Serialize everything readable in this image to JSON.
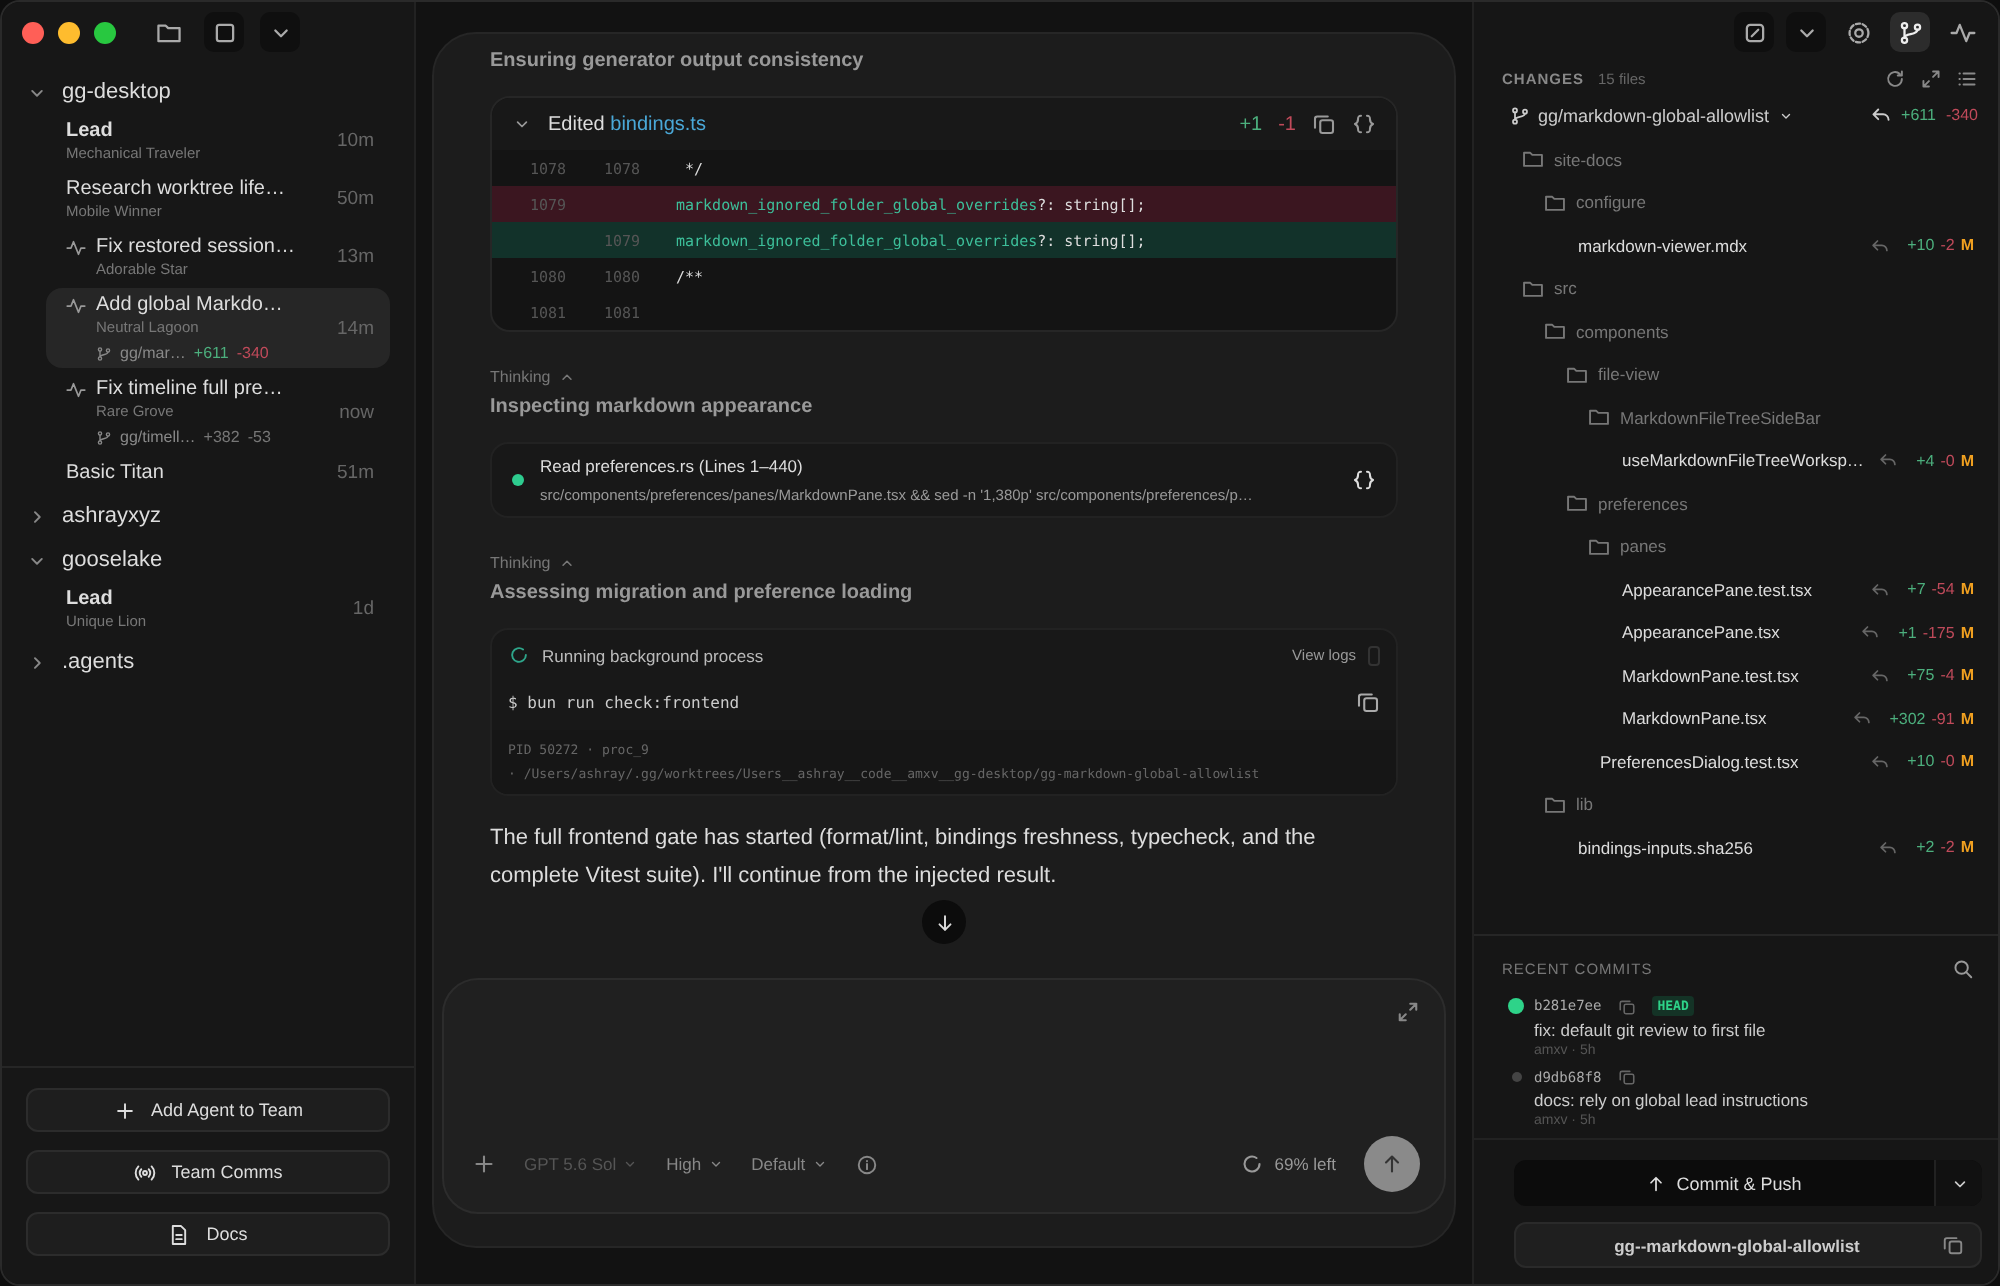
{
  "titlebar": {
    "left_tools": [
      {
        "kind": "folder"
      },
      {
        "kind": "square"
      },
      {
        "kind": "caret"
      }
    ],
    "right_tools": [
      {
        "kind": "editor",
        "selected": false
      },
      {
        "kind": "caret",
        "selected": false
      },
      {
        "kind": "gear",
        "selected": false
      },
      {
        "kind": "branch",
        "selected": true
      },
      {
        "kind": "activity",
        "selected": false
      }
    ]
  },
  "sidebar": {
    "projects": [
      {
        "name": "gg-desktop",
        "expanded": true,
        "agents": [
          {
            "kind": "lead",
            "title": "Lead",
            "subtitle": "Mechanical Traveler",
            "time": "10m",
            "activity": false,
            "selected": false
          },
          {
            "kind": "task",
            "title": "Research worktree life…",
            "subtitle": "Mobile Winner",
            "time": "50m",
            "activity": false,
            "selected": false
          },
          {
            "kind": "task",
            "title": "Fix restored session…",
            "subtitle": "Adorable Star",
            "time": "13m",
            "activity": true,
            "selected": false
          },
          {
            "kind": "task",
            "title": "Add global Markdo…",
            "subtitle": "Neutral Lagoon",
            "time": "14m",
            "activity": true,
            "selected": true,
            "branch": "gg/mar…",
            "added": "+611",
            "removed": "-340"
          },
          {
            "kind": "task",
            "title": "Fix timeline full pre…",
            "subtitle": "Rare Grove",
            "time": "now",
            "activity": true,
            "selected": false,
            "branch": "gg/timell…",
            "added": "+382",
            "removed": "-53"
          },
          {
            "kind": "task",
            "title": "Basic Titan",
            "time": "51m",
            "activity": false,
            "selected": false
          }
        ]
      },
      {
        "name": "ashrayxyz",
        "expanded": false
      },
      {
        "name": "gooselake",
        "expanded": true,
        "agents": [
          {
            "kind": "lead",
            "title": "Lead",
            "subtitle": "Unique Lion",
            "time": "1d",
            "activity": false,
            "selected": false
          }
        ]
      },
      {
        "name": ".agents",
        "expanded": false
      }
    ],
    "buttons": [
      {
        "kind": "plus",
        "label": "Add Agent to Team"
      },
      {
        "kind": "broadcast",
        "label": "Team Comms"
      },
      {
        "kind": "doc",
        "label": "Docs"
      }
    ]
  },
  "conversation": {
    "intro": "Ensuring generator output consistency",
    "blocks": [
      {
        "kind": "diff",
        "action": "Edited",
        "file": "bindings.ts",
        "added": "+1",
        "removed": "-1",
        "lines": [
          {
            "kind": "context",
            "old": "1078",
            "new": "1078",
            "code": " */"
          },
          {
            "kind": "removed",
            "old": "1079",
            "identifier": "markdown_ignored_folder_global_overrides",
            "code": "?: string[];"
          },
          {
            "kind": "added",
            "new": "1079",
            "identifier": "markdown_ignored_folder_global_overrides",
            "code": "?: string[];"
          },
          {
            "kind": "context",
            "old": "1080",
            "new": "1080",
            "code": "/**"
          },
          {
            "kind": "context",
            "old": "1081",
            "new": "1081"
          }
        ]
      },
      {
        "kind": "thinking",
        "label": "Thinking",
        "expanded": true,
        "title": "Inspecting markdown appearance"
      },
      {
        "kind": "tool",
        "done": true,
        "title": "Read preferences.rs (Lines 1–440)",
        "detail": "src/components/preferences/panes/MarkdownPane.tsx && sed -n '1,380p' src/components/preferences/p…"
      },
      {
        "kind": "thinking",
        "label": "Thinking",
        "expanded": true,
        "title": "Assessing migration and preference loading"
      },
      {
        "kind": "process",
        "title": "Running background process",
        "action": "View logs",
        "command": "$ bun run check:frontend",
        "meta": "PID 50272 · proc_9",
        "path": "· /Users/ashray/.gg/worktrees/Users__ashray__code__amxv__gg-desktop/gg-markdown-global-allowlist"
      },
      {
        "kind": "message",
        "text": "The full frontend gate has started (format/lint, bindings freshness, typecheck, and the complete Vitest suite). I'll continue from the injected result."
      }
    ]
  },
  "composer": {
    "model": "GPT 5.6 Sol",
    "effort": "High",
    "mode": "Default",
    "context": "69% left"
  },
  "changes": {
    "title": "CHANGES",
    "count": "15 files",
    "branch": "gg/markdown-global-allowlist",
    "added": "+611",
    "removed": "-340",
    "tree": [
      {
        "name": "site-docs",
        "children": [
          {
            "name": "configure",
            "children": [
              {
                "name": "markdown-viewer.mdx",
                "added": "+10",
                "removed": "-2",
                "status": "M"
              }
            ]
          }
        ]
      },
      {
        "name": "src",
        "children": [
          {
            "name": "components",
            "children": [
              {
                "name": "file-view",
                "children": [
                  {
                    "name": "MarkdownFileTreeSideBar",
                    "children": [
                      {
                        "name": "useMarkdownFileTreeWorksp…",
                        "added": "+4",
                        "removed": "-0",
                        "status": "M"
                      }
                    ]
                  }
                ]
              },
              {
                "name": "preferences",
                "children": [
                  {
                    "name": "panes",
                    "children": [
                      {
                        "name": "AppearancePane.test.tsx",
                        "added": "+7",
                        "removed": "-54",
                        "status": "M"
                      },
                      {
                        "name": "AppearancePane.tsx",
                        "added": "+1",
                        "removed": "-175",
                        "status": "M"
                      },
                      {
                        "name": "MarkdownPane.test.tsx",
                        "added": "+75",
                        "removed": "-4",
                        "status": "M"
                      },
                      {
                        "name": "MarkdownPane.tsx",
                        "added": "+302",
                        "removed": "-91",
                        "status": "M"
                      }
                    ]
                  },
                  {
                    "name": "PreferencesDialog.test.tsx",
                    "added": "+10",
                    "removed": "-0",
                    "status": "M"
                  }
                ]
              }
            ]
          },
          {
            "name": "lib",
            "children": [
              {
                "name": "bindings-inputs.sha256",
                "added": "+2",
                "removed": "-2",
                "status": "M"
              }
            ]
          }
        ]
      }
    ]
  },
  "commits": {
    "title": "RECENT COMMITS",
    "items": [
      {
        "hash": "b281e7ee",
        "head": "HEAD",
        "current": true,
        "message": "fix: default git review to first file",
        "meta": "amxv · 5h"
      },
      {
        "hash": "d9db68f8",
        "current": false,
        "message": "docs: rely on global lead instructions",
        "meta": "amxv · 5h"
      }
    ]
  },
  "actions": {
    "commit": "Commit & Push",
    "worktree": "gg--markdown-global-allowlist"
  }
}
